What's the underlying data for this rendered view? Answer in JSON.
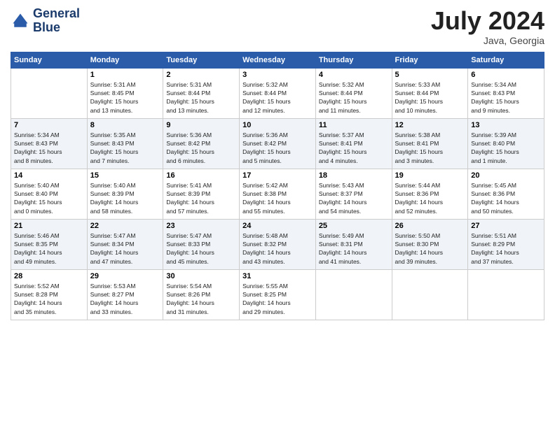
{
  "header": {
    "logo_line1": "General",
    "logo_line2": "Blue",
    "month_title": "July 2024",
    "subtitle": "Java, Georgia"
  },
  "days_of_week": [
    "Sunday",
    "Monday",
    "Tuesday",
    "Wednesday",
    "Thursday",
    "Friday",
    "Saturday"
  ],
  "weeks": [
    [
      {
        "num": "",
        "info": ""
      },
      {
        "num": "1",
        "info": "Sunrise: 5:31 AM\nSunset: 8:45 PM\nDaylight: 15 hours\nand 13 minutes."
      },
      {
        "num": "2",
        "info": "Sunrise: 5:31 AM\nSunset: 8:44 PM\nDaylight: 15 hours\nand 13 minutes."
      },
      {
        "num": "3",
        "info": "Sunrise: 5:32 AM\nSunset: 8:44 PM\nDaylight: 15 hours\nand 12 minutes."
      },
      {
        "num": "4",
        "info": "Sunrise: 5:32 AM\nSunset: 8:44 PM\nDaylight: 15 hours\nand 11 minutes."
      },
      {
        "num": "5",
        "info": "Sunrise: 5:33 AM\nSunset: 8:44 PM\nDaylight: 15 hours\nand 10 minutes."
      },
      {
        "num": "6",
        "info": "Sunrise: 5:34 AM\nSunset: 8:43 PM\nDaylight: 15 hours\nand 9 minutes."
      }
    ],
    [
      {
        "num": "7",
        "info": "Sunrise: 5:34 AM\nSunset: 8:43 PM\nDaylight: 15 hours\nand 8 minutes."
      },
      {
        "num": "8",
        "info": "Sunrise: 5:35 AM\nSunset: 8:43 PM\nDaylight: 15 hours\nand 7 minutes."
      },
      {
        "num": "9",
        "info": "Sunrise: 5:36 AM\nSunset: 8:42 PM\nDaylight: 15 hours\nand 6 minutes."
      },
      {
        "num": "10",
        "info": "Sunrise: 5:36 AM\nSunset: 8:42 PM\nDaylight: 15 hours\nand 5 minutes."
      },
      {
        "num": "11",
        "info": "Sunrise: 5:37 AM\nSunset: 8:41 PM\nDaylight: 15 hours\nand 4 minutes."
      },
      {
        "num": "12",
        "info": "Sunrise: 5:38 AM\nSunset: 8:41 PM\nDaylight: 15 hours\nand 3 minutes."
      },
      {
        "num": "13",
        "info": "Sunrise: 5:39 AM\nSunset: 8:40 PM\nDaylight: 15 hours\nand 1 minute."
      }
    ],
    [
      {
        "num": "14",
        "info": "Sunrise: 5:40 AM\nSunset: 8:40 PM\nDaylight: 15 hours\nand 0 minutes."
      },
      {
        "num": "15",
        "info": "Sunrise: 5:40 AM\nSunset: 8:39 PM\nDaylight: 14 hours\nand 58 minutes."
      },
      {
        "num": "16",
        "info": "Sunrise: 5:41 AM\nSunset: 8:39 PM\nDaylight: 14 hours\nand 57 minutes."
      },
      {
        "num": "17",
        "info": "Sunrise: 5:42 AM\nSunset: 8:38 PM\nDaylight: 14 hours\nand 55 minutes."
      },
      {
        "num": "18",
        "info": "Sunrise: 5:43 AM\nSunset: 8:37 PM\nDaylight: 14 hours\nand 54 minutes."
      },
      {
        "num": "19",
        "info": "Sunrise: 5:44 AM\nSunset: 8:36 PM\nDaylight: 14 hours\nand 52 minutes."
      },
      {
        "num": "20",
        "info": "Sunrise: 5:45 AM\nSunset: 8:36 PM\nDaylight: 14 hours\nand 50 minutes."
      }
    ],
    [
      {
        "num": "21",
        "info": "Sunrise: 5:46 AM\nSunset: 8:35 PM\nDaylight: 14 hours\nand 49 minutes."
      },
      {
        "num": "22",
        "info": "Sunrise: 5:47 AM\nSunset: 8:34 PM\nDaylight: 14 hours\nand 47 minutes."
      },
      {
        "num": "23",
        "info": "Sunrise: 5:47 AM\nSunset: 8:33 PM\nDaylight: 14 hours\nand 45 minutes."
      },
      {
        "num": "24",
        "info": "Sunrise: 5:48 AM\nSunset: 8:32 PM\nDaylight: 14 hours\nand 43 minutes."
      },
      {
        "num": "25",
        "info": "Sunrise: 5:49 AM\nSunset: 8:31 PM\nDaylight: 14 hours\nand 41 minutes."
      },
      {
        "num": "26",
        "info": "Sunrise: 5:50 AM\nSunset: 8:30 PM\nDaylight: 14 hours\nand 39 minutes."
      },
      {
        "num": "27",
        "info": "Sunrise: 5:51 AM\nSunset: 8:29 PM\nDaylight: 14 hours\nand 37 minutes."
      }
    ],
    [
      {
        "num": "28",
        "info": "Sunrise: 5:52 AM\nSunset: 8:28 PM\nDaylight: 14 hours\nand 35 minutes."
      },
      {
        "num": "29",
        "info": "Sunrise: 5:53 AM\nSunset: 8:27 PM\nDaylight: 14 hours\nand 33 minutes."
      },
      {
        "num": "30",
        "info": "Sunrise: 5:54 AM\nSunset: 8:26 PM\nDaylight: 14 hours\nand 31 minutes."
      },
      {
        "num": "31",
        "info": "Sunrise: 5:55 AM\nSunset: 8:25 PM\nDaylight: 14 hours\nand 29 minutes."
      },
      {
        "num": "",
        "info": ""
      },
      {
        "num": "",
        "info": ""
      },
      {
        "num": "",
        "info": ""
      }
    ]
  ]
}
